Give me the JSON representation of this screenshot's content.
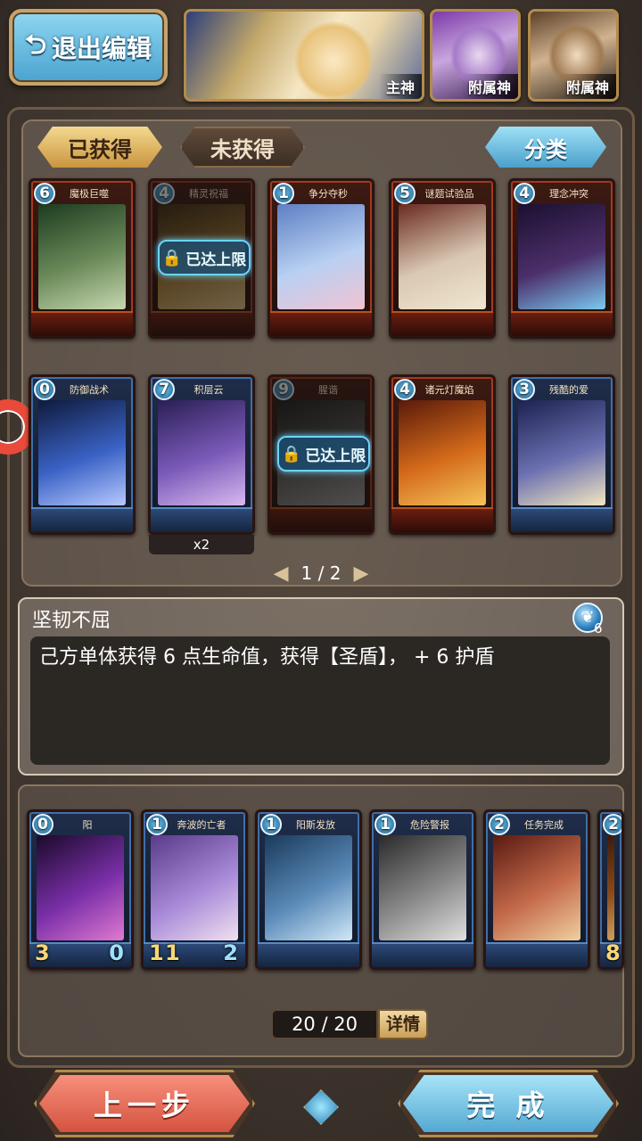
{
  "header": {
    "exit_label": "退出编辑",
    "main_god_label": "主神",
    "sub_god_label_1": "附属神",
    "sub_god_label_2": "附属神"
  },
  "tabs": {
    "owned": "已获得",
    "unowned": "未获得",
    "sort": "分类"
  },
  "collection": {
    "cards": [
      {
        "cost": "6",
        "name": "魔极巨噬",
        "limited": false,
        "art": [
          "#1c3b1e",
          "#6b8a5a",
          "#c6d7b0"
        ]
      },
      {
        "cost": "4",
        "name": "精灵祝福",
        "limited": true,
        "art": [
          "#3b2a14",
          "#a47a34",
          "#e1c48a"
        ]
      },
      {
        "cost": "1",
        "name": "争分夺秒",
        "limited": false,
        "art": [
          "#5d7fc4",
          "#b9d0f2",
          "#f0c3d3"
        ]
      },
      {
        "cost": "5",
        "name": "谜题试验品",
        "limited": false,
        "art": [
          "#6a2a22",
          "#d9c8b2",
          "#f1e6d0"
        ]
      },
      {
        "cost": "4",
        "name": "理念冲突",
        "limited": false,
        "art": [
          "#1a1030",
          "#4c2f6a",
          "#7ac9f0"
        ]
      },
      {
        "cost": "0",
        "name": "防御战术",
        "limited": false,
        "art": [
          "#0f1a3c",
          "#3a62c4",
          "#b7c8ff"
        ]
      },
      {
        "cost": "7",
        "name": "积层云",
        "limited": false,
        "art": [
          "#2a1f55",
          "#7a5ab8",
          "#d8b9f0"
        ]
      },
      {
        "cost": "9",
        "name": "腥谐",
        "limited": true,
        "art": [
          "#1e1e1e",
          "#5a5a5a",
          "#9a9a9a"
        ]
      },
      {
        "cost": "4",
        "name": "诸元灯魔焰",
        "limited": false,
        "art": [
          "#5a1a0a",
          "#d46a1a",
          "#f4c35a"
        ]
      },
      {
        "cost": "3",
        "name": "残酷的爱",
        "limited": false,
        "art": [
          "#1c2250",
          "#6a6fb0",
          "#f3e7c0"
        ]
      }
    ],
    "dup_label": "x2",
    "limit_text": "已达上限",
    "page": "1 / 2"
  },
  "detail": {
    "title": "坚韧不屈",
    "mana_cost": "6",
    "description": "己方单体获得 6 点生命值，获得【圣盾】， + 6 护盾"
  },
  "deck": {
    "cards": [
      {
        "cost": "0",
        "name": "阳",
        "atk": "3",
        "hp": "0",
        "art": [
          "#1a0a2a",
          "#7a2fa8",
          "#e07ad0"
        ]
      },
      {
        "cost": "1",
        "name": "奔波的亡者",
        "atk": "1",
        "hp": "2",
        "hp2": "1",
        "art": [
          "#5a3a8a",
          "#a88ad8",
          "#f0e0f0"
        ]
      },
      {
        "cost": "1",
        "name": "阳斯发放",
        "atk": "",
        "hp": "",
        "art": [
          "#1a3a5a",
          "#5a8ab8",
          "#d0e8f8"
        ]
      },
      {
        "cost": "1",
        "name": "危险警报",
        "atk": "",
        "hp": "",
        "art": [
          "#2a2a2a",
          "#8a8a8a",
          "#e0e0e0"
        ]
      },
      {
        "cost": "2",
        "name": "任务完成",
        "atk": "",
        "hp": "",
        "art": [
          "#5a1a12",
          "#c46a4a",
          "#f0d0a0"
        ]
      },
      {
        "cost": "2",
        "name": "",
        "atk": "8",
        "hp": "",
        "art": [
          "#3a1a0a",
          "#8a4a1a",
          "#d0a060"
        ]
      }
    ],
    "count": "20 / 20",
    "detail_label": "详情"
  },
  "footer": {
    "prev_label": "上一步",
    "done_label": "完 成"
  }
}
